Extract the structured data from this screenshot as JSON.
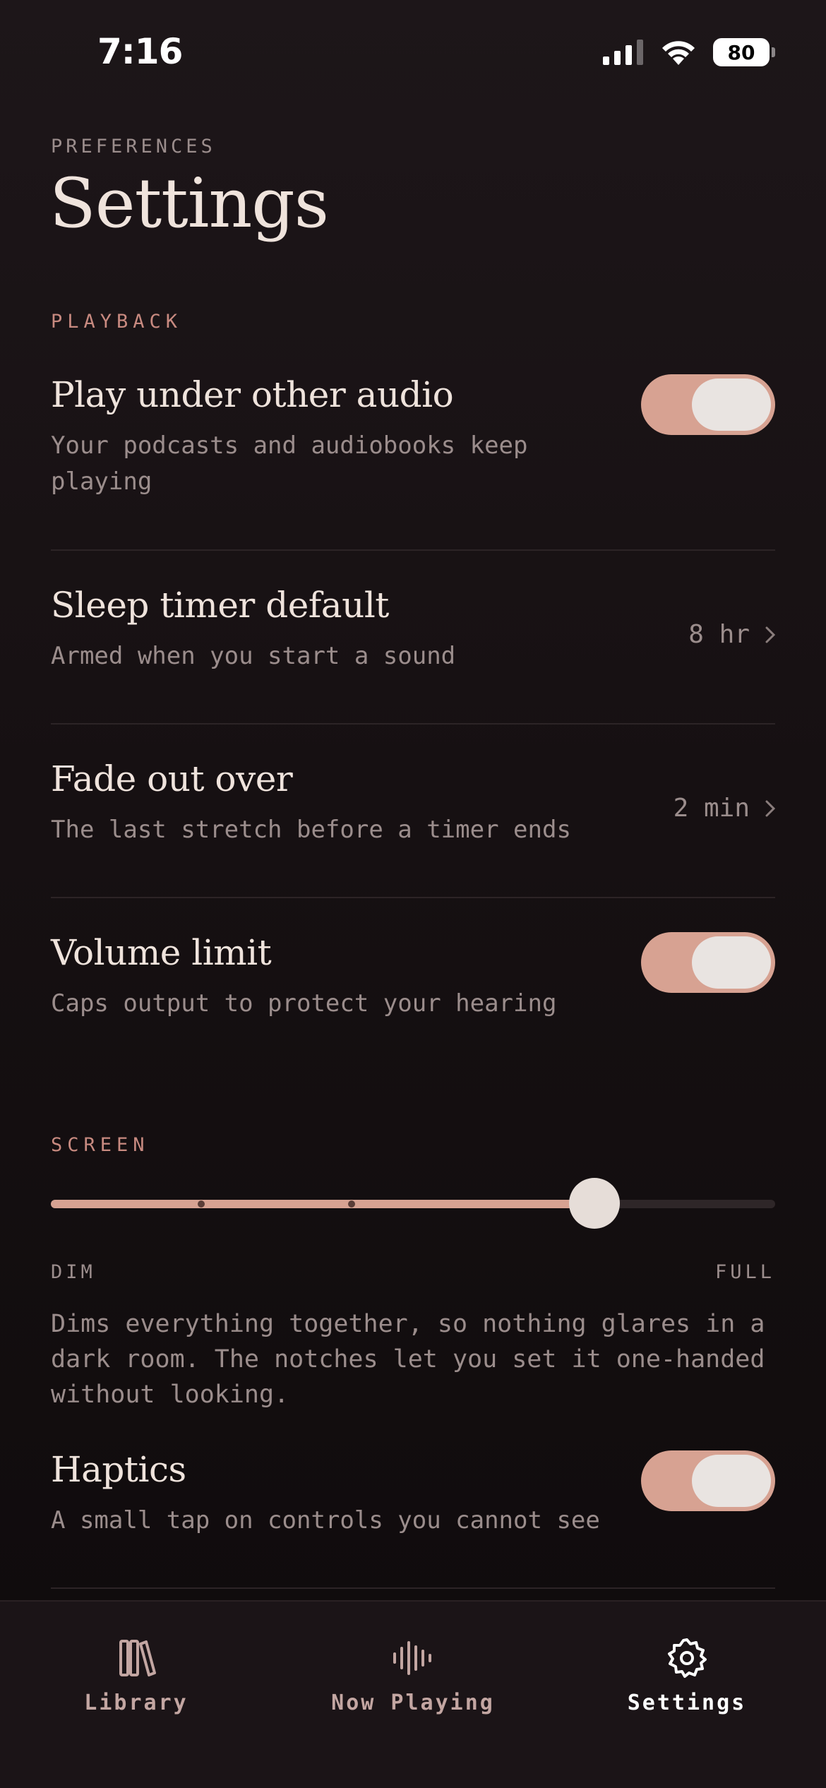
{
  "status_bar": {
    "time": "7:16",
    "battery": "80",
    "icons": [
      "cellular-signal-icon",
      "wifi-icon",
      "battery-icon"
    ]
  },
  "header": {
    "eyebrow": "PREFERENCES",
    "title": "Settings"
  },
  "playback": {
    "label": "PLAYBACK",
    "play_under": {
      "title": "Play under other audio",
      "subtitle": "Your podcasts and audiobooks keep playing",
      "enabled": true
    },
    "sleep_timer": {
      "title": "Sleep timer default",
      "subtitle": "Armed when you start a sound",
      "value": "8 hr"
    },
    "fade_out": {
      "title": "Fade out over",
      "subtitle": "The last stretch before a timer ends",
      "value": "2 min"
    },
    "volume_limit": {
      "title": "Volume limit",
      "subtitle": "Caps output to protect your hearing",
      "enabled": true
    }
  },
  "screen": {
    "label": "SCREEN",
    "brightness_fraction": 0.75,
    "notches": [
      0.25,
      0.5,
      0.75
    ],
    "min_label": "DIM",
    "max_label": "FULL",
    "description": "Dims everything together, so nothing glares in a dark room. The notches let you set it one-handed without looking."
  },
  "haptics": {
    "title": "Haptics",
    "subtitle": "A small tap on controls you cannot see",
    "enabled": true
  },
  "tabs": [
    {
      "label": "Library",
      "icon": "library-books-icon",
      "active": false
    },
    {
      "label": "Now Playing",
      "icon": "waveform-icon",
      "active": false
    },
    {
      "label": "Settings",
      "icon": "gear-icon",
      "active": true
    }
  ],
  "colors": {
    "accent": "#d7a292",
    "section_label": "#c88a80",
    "background": "#161012",
    "muted_text": "#9b8d8c"
  }
}
